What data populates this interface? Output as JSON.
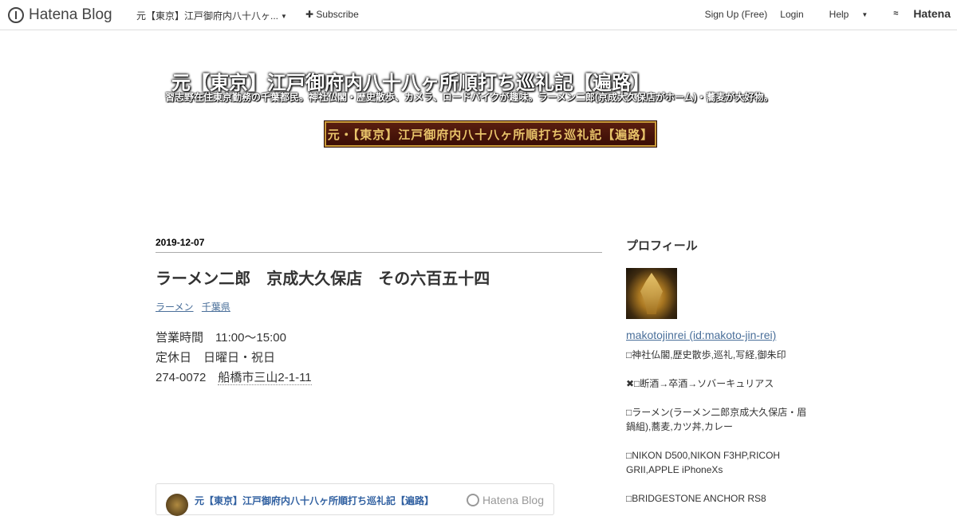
{
  "globalbar": {
    "logo_text": "Hatena Blog",
    "blog_name": "元【東京】江戸御府内八十八ヶ...",
    "subscribe": "Subscribe",
    "signup": "Sign Up (Free)",
    "login": "Login",
    "help": "Help",
    "brand": "Hatena"
  },
  "header": {
    "title": "元【東京】江戸御府内八十八ヶ所順打ち巡礼記【遍路】",
    "description": "習志野在住東京勤務の千葉都民。神社仏閣・歴史散歩、カメラ、ロードバイクが趣味。ラーメン二郎(京成大久保店がホーム)・蕎麦が大好物。",
    "banner_text": "元・【東京】江戸御府内八十八ヶ所順打ち巡礼記【遍路】"
  },
  "entry": {
    "date": "2019-12-07",
    "title": "ラーメン二郎　京成大久保店　その六百五十四",
    "categories": [
      "ラーメン",
      "千葉県"
    ],
    "body": {
      "line1": "営業時間　11:00～15:00",
      "line2": "定休日　日曜日・祝日",
      "line3_zip": "274-0072　",
      "line3_addr": "船橋市三山2-1-11"
    }
  },
  "embed": {
    "title": "元【東京】江戸御府内八十八ヶ所順打ち巡礼記【遍路】",
    "brand": "Hatena Blog"
  },
  "sidebar": {
    "heading": "プロフィール",
    "profile_link": "makotojinrei (id:makoto-jin-rei)",
    "lines": [
      "□神社仏閣,歴史散歩,巡礼,写経,御朱印",
      "✖□断酒→卒酒→ソバーキュリアス",
      "□ラーメン(ラーメン二郎京成大久保店・眉鍋組),蕎麦,カツ丼,カレー",
      "□NIKON D500,NIKON F3HP,RICOH GRII,APPLE iPhoneXs",
      "□BRIDGESTONE ANCHOR RS8"
    ]
  }
}
